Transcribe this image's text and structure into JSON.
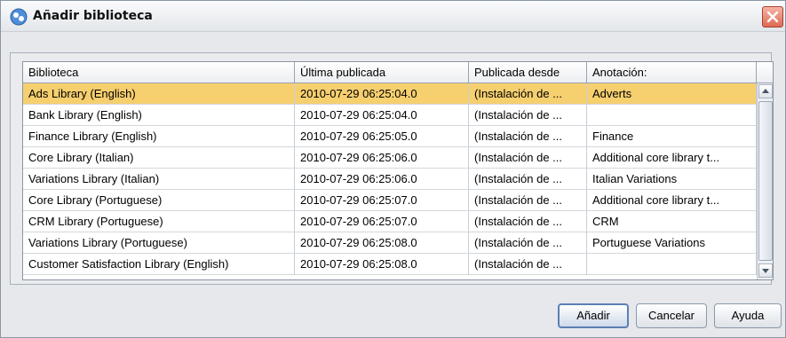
{
  "window": {
    "title": "Añadir biblioteca",
    "title_icon": "library-add-icon",
    "close_icon": "close-icon"
  },
  "table": {
    "columns": [
      "Biblioteca",
      "Última publicada",
      "Publicada desde",
      "Anotación:"
    ],
    "rows": [
      [
        "Ads Library (English)",
        "2010-07-29 06:25:04.0",
        "(Instalación de ...",
        "Adverts"
      ],
      [
        "Bank Library (English)",
        "2010-07-29 06:25:04.0",
        "(Instalación de ...",
        ""
      ],
      [
        "Finance Library (English)",
        "2010-07-29 06:25:05.0",
        "(Instalación de ...",
        "Finance"
      ],
      [
        "Core Library (Italian)",
        "2010-07-29 06:25:06.0",
        "(Instalación de ...",
        "Additional core library t..."
      ],
      [
        "Variations Library (Italian)",
        "2010-07-29 06:25:06.0",
        "(Instalación de ...",
        "Italian Variations"
      ],
      [
        "Core Library (Portuguese)",
        "2010-07-29 06:25:07.0",
        "(Instalación de ...",
        "Additional core library t..."
      ],
      [
        "CRM Library (Portuguese)",
        "2010-07-29 06:25:07.0",
        "(Instalación de ...",
        "CRM"
      ],
      [
        "Variations Library (Portuguese)",
        "2010-07-29 06:25:08.0",
        "(Instalación de ...",
        "Portuguese Variations"
      ],
      [
        "Customer Satisfaction Library (English)",
        "2010-07-29 06:25:08.0",
        "(Instalación de ...",
        ""
      ]
    ],
    "selected_row": 0
  },
  "buttons": {
    "add": "Añadir",
    "cancel": "Cancelar",
    "help": "Ayuda"
  },
  "colors": {
    "selection": "#f6cf6f",
    "primary_border": "#5c7fb3",
    "close_button": "#de6a52"
  }
}
